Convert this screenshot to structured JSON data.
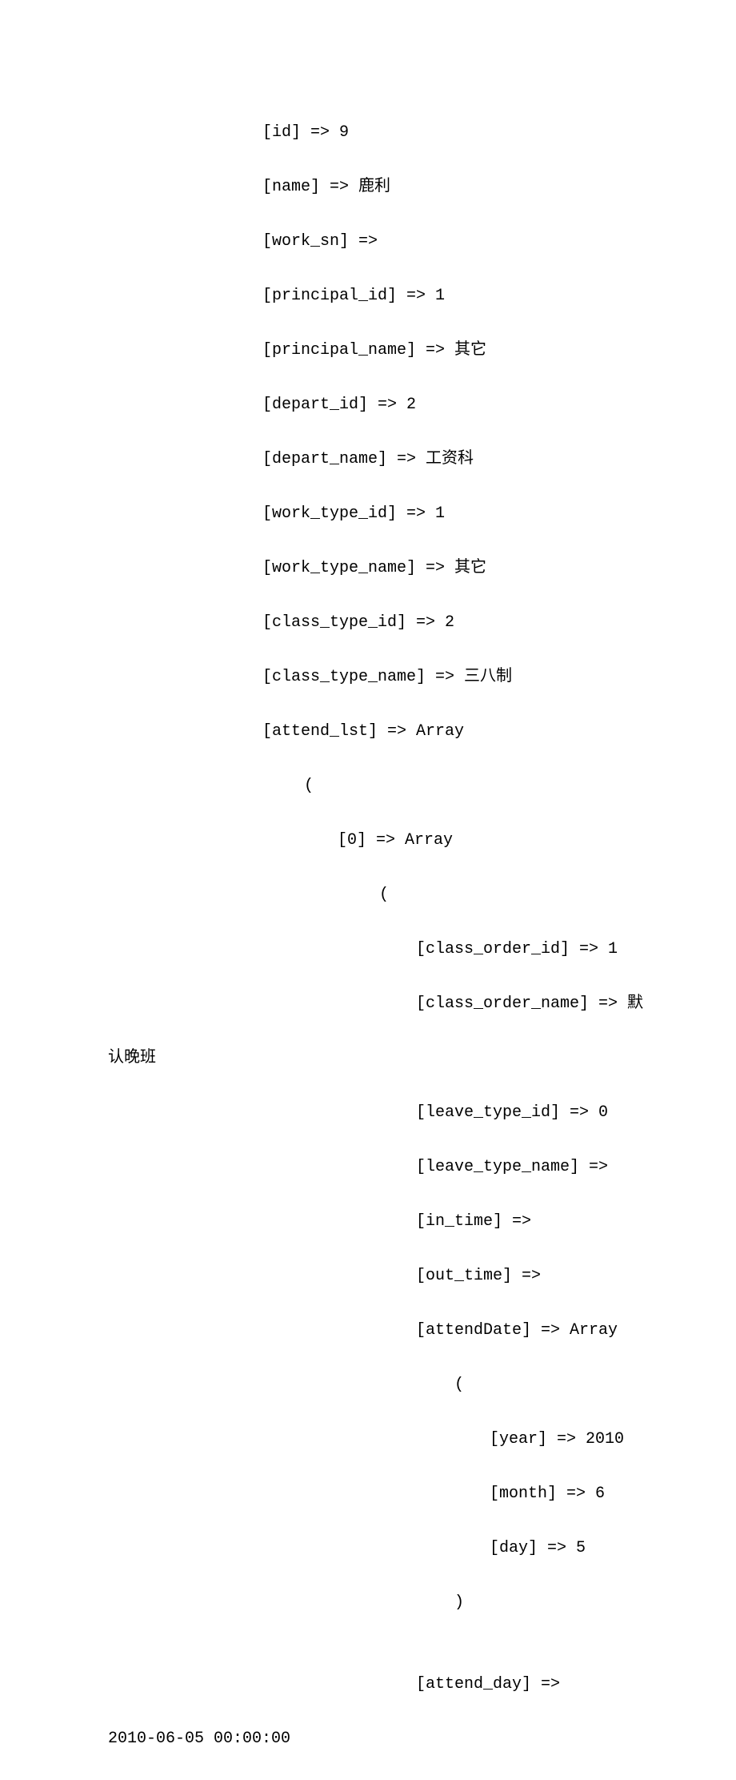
{
  "record": {
    "id_label": "[id] => 9",
    "name_label": "[name] => 鹿利",
    "work_sn_label": "[work_sn] =>",
    "principal_id_label": "[principal_id] => 1",
    "principal_name_label": "[principal_name] => 其它",
    "depart_id_label": "[depart_id] => 2",
    "depart_name_label": "[depart_name] => 工资科",
    "work_type_id_label": "[work_type_id] => 1",
    "work_type_name_label": "[work_type_name] => 其它",
    "class_type_id_label": "[class_type_id] => 2",
    "class_type_name_label": "[class_type_name] => 三八制",
    "attend_lst_label": "[attend_lst] => Array",
    "paren_open_lvl2": "(",
    "idx0_label": "[0] => Array",
    "paren_open_lvl4": "(",
    "class_order_id_label": "[class_order_id] => 1",
    "class_order_name_label": "[class_order_name] => 默",
    "wrap_line_1": "认晚班",
    "leave_type_id_label": "[leave_type_id] => 0",
    "leave_type_name_label": "[leave_type_name] =>",
    "in_time_label": "[in_time] =>",
    "out_time_label": "[out_time] =>",
    "attend_date_label": "[attendDate] => Array",
    "paren_open_lvl6": "(",
    "year_label": "[year] => 2010",
    "month_label": "[month] => 6",
    "day_label": "[day] => 5",
    "paren_close_lvl6": ")",
    "blank": "",
    "attend_day_label": "[attend_day] =>",
    "wrap_line_2": "2010-06-05 00:00:00"
  }
}
